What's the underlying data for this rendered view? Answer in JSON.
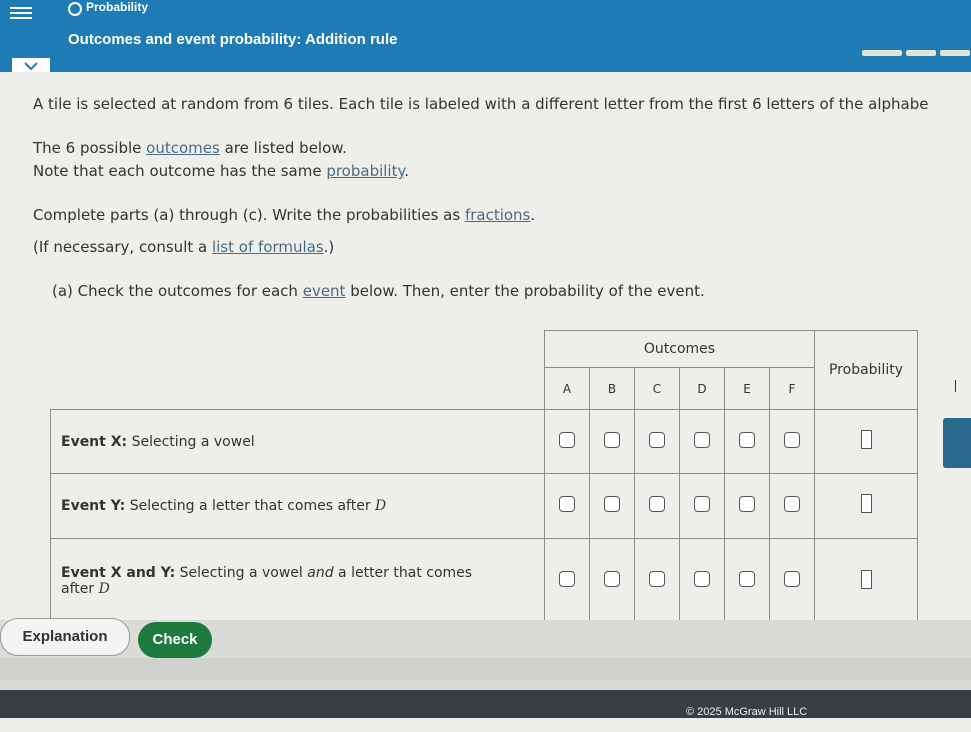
{
  "header": {
    "topic": "Probability",
    "title": "Outcomes and event probability: Addition rule"
  },
  "problem": {
    "line1": "A tile is selected at random from 6 tiles. Each tile is labeled with a different letter from the first 6 letters of the alphabe",
    "line2_pre": "The 6 possible ",
    "line2_link": "outcomes",
    "line2_post": " are listed below.",
    "line3_pre": "Note that each outcome has the same ",
    "line3_link": "probability",
    "line3_post": ".",
    "line4_pre": "Complete parts (a) through (c). Write the probabilities as ",
    "line4_link": "fractions",
    "line4_post": ".",
    "line5_pre": "(If necessary, consult a ",
    "line5_link": "list of formulas",
    "line5_post": ".)",
    "part_a_pre": "(a) Check the outcomes for each ",
    "part_a_link": "event",
    "part_a_post": " below. Then, enter the probability of the event."
  },
  "table": {
    "outcomes_header": "Outcomes",
    "probability_header": "Probability",
    "letters": [
      "A",
      "B",
      "C",
      "D",
      "E",
      "F"
    ],
    "events": [
      {
        "name": "Event X:",
        "desc": " Selecting a vowel",
        "desc2": ""
      },
      {
        "name": "Event Y:",
        "desc": " Selecting a letter that comes after ",
        "math": "D",
        "desc2": ""
      },
      {
        "name": "Event X and Y:",
        "desc": " Selecting a vowel ",
        "and": "and",
        "desc_b": " a letter that comes",
        "desc2": "after ",
        "math": "D"
      }
    ]
  },
  "buttons": {
    "explanation": "Explanation",
    "check": "Check"
  },
  "footer": {
    "copyright": "© 2025 McGraw Hill LLC"
  }
}
